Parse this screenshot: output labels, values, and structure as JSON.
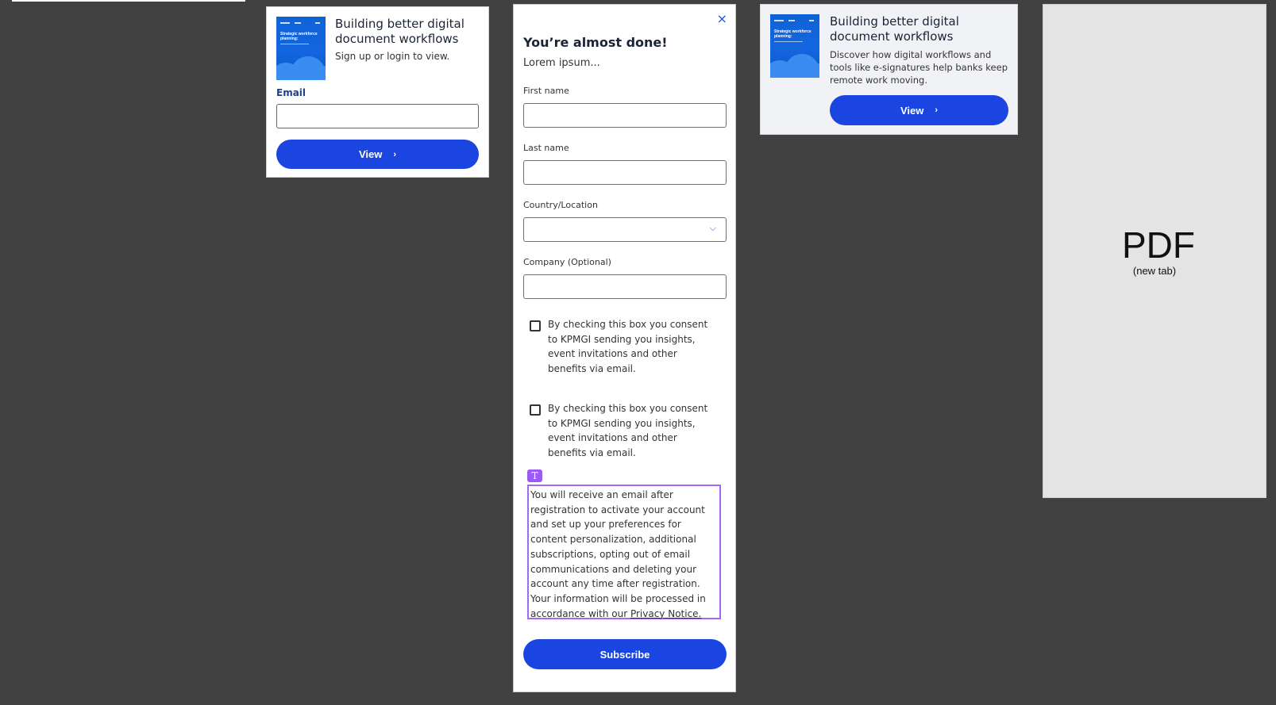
{
  "card_signup": {
    "title": "Building better digital document workflows",
    "subtitle": "Sign up or login to view.",
    "email_label": "Email",
    "email_value": "",
    "view_label": "View",
    "thumbnail_title": "Strategic workforce planning:"
  },
  "form": {
    "close_icon": "×",
    "title": "You’re almost done!",
    "subtitle": "Lorem ipsum...",
    "fields": {
      "first_name": {
        "label": "First name",
        "value": ""
      },
      "last_name": {
        "label": "Last name",
        "value": ""
      },
      "country": {
        "label": "Country/Location",
        "value": ""
      },
      "company": {
        "label": "Company (Optional)",
        "value": ""
      }
    },
    "consent_1": "By checking this box you consent to KPMGI sending you insights, event invitations and other benefits via email.",
    "consent_2": "By checking this box you consent to KPMGI sending you insights, event invitations and other benefits via email.",
    "text_badge": "T",
    "notice_text": "You will receive an email after registration to activate your account and set up your preferences for content personalization, additional subscriptions, opting out of email communications and deleting your account any time after registration. Your information will be processed in accordance with our ",
    "notice_link": "Privacy Notice.",
    "subscribe_label": "Subscribe"
  },
  "card_logged": {
    "title": "Building better digital document workflows",
    "description": "Discover how digital workflows and tools like e-signatures help banks keep remote work moving.",
    "view_label": "View",
    "thumbnail_title": "Strategic workforce planning:"
  },
  "pdf_panel": {
    "label": "PDF",
    "sublabel": "(new tab)"
  },
  "colors": {
    "primary_button": "#1b45e0",
    "text_selection": "#a567f7",
    "background": "#414141"
  },
  "icons": [
    "close-icon",
    "chevron-right-icon",
    "chevron-down-icon",
    "text-tool-icon"
  ]
}
